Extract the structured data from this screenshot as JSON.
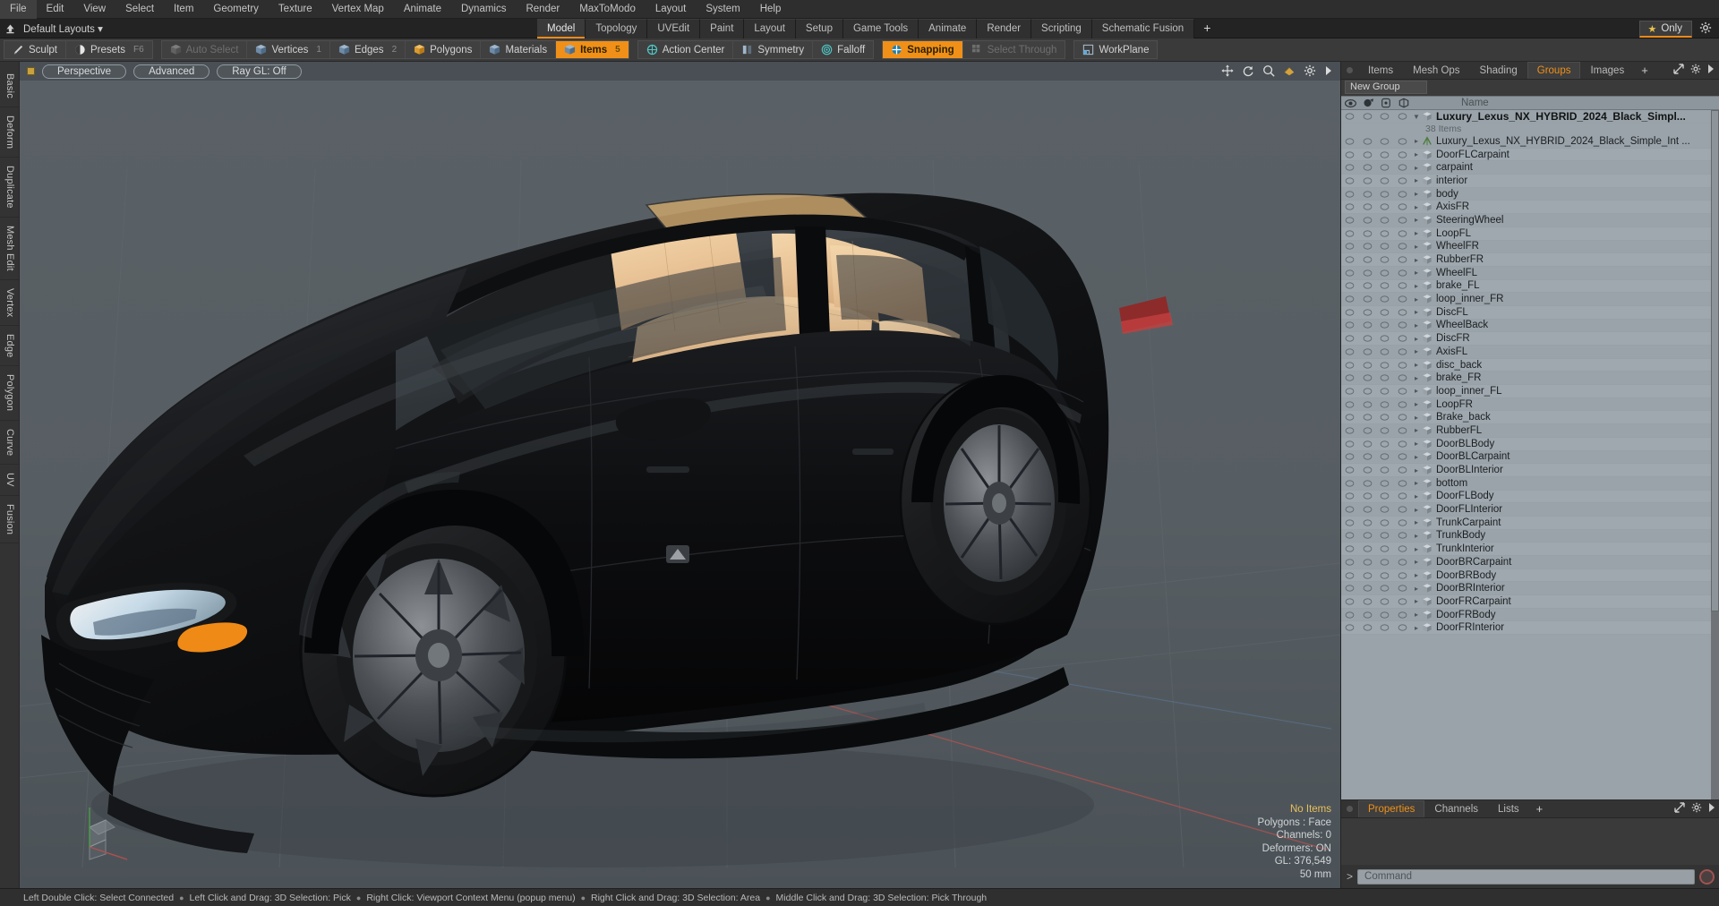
{
  "menubar": {
    "items": [
      "File",
      "Edit",
      "View",
      "Select",
      "Item",
      "Geometry",
      "Texture",
      "Vertex Map",
      "Animate",
      "Dynamics",
      "Render",
      "MaxToModo",
      "Layout",
      "System",
      "Help"
    ]
  },
  "layoutbar": {
    "home_icon": "home-up-arrow-icon",
    "layouts_label": "Default Layouts",
    "layouts_caret": "▾",
    "tabs": [
      {
        "label": "Model",
        "active": true
      },
      {
        "label": "Topology",
        "active": false
      },
      {
        "label": "UVEdit",
        "active": false
      },
      {
        "label": "Paint",
        "active": false
      },
      {
        "label": "Layout",
        "active": false
      },
      {
        "label": "Setup",
        "active": false
      },
      {
        "label": "Game Tools",
        "active": false
      },
      {
        "label": "Animate",
        "active": false
      },
      {
        "label": "Render",
        "active": false
      },
      {
        "label": "Scripting",
        "active": false
      },
      {
        "label": "Schematic Fusion",
        "active": false
      }
    ],
    "add_tab_label": "+",
    "only_label": "Only",
    "only_star": "★",
    "gear_icon": "gear-icon"
  },
  "modebar": {
    "groups": [
      {
        "buttons": [
          {
            "label": "Sculpt",
            "icon": "brush-icon",
            "state": "normal",
            "key": ""
          },
          {
            "label": "Presets",
            "icon": "sphere-icon",
            "state": "normal",
            "key": "F6"
          }
        ]
      },
      {
        "buttons": [
          {
            "label": "Auto Select",
            "icon": "cube-grey-icon",
            "state": "dim",
            "key": ""
          },
          {
            "label": "Vertices",
            "icon": "cube-blue-icon",
            "state": "normal",
            "key": "1"
          },
          {
            "label": "Edges",
            "icon": "cube-blue-icon",
            "state": "normal",
            "key": "2"
          },
          {
            "label": "Polygons",
            "icon": "cube-orange-icon",
            "state": "normal",
            "key": ""
          },
          {
            "label": "Materials",
            "icon": "cube-blue-icon",
            "state": "normal",
            "key": ""
          },
          {
            "label": "Items",
            "icon": "cube-blue-icon",
            "state": "on",
            "key": "5"
          }
        ]
      },
      {
        "buttons": [
          {
            "label": "Action Center",
            "icon": "action-center-icon",
            "state": "normal",
            "key": ""
          },
          {
            "label": "Symmetry",
            "icon": "symmetry-icon",
            "state": "normal",
            "key": ""
          },
          {
            "label": "Falloff",
            "icon": "falloff-icon",
            "state": "normal",
            "key": ""
          }
        ]
      },
      {
        "buttons": [
          {
            "label": "Snapping",
            "icon": "snapping-icon",
            "state": "on",
            "key": ""
          },
          {
            "label": "Select Through",
            "icon": "select-through-icon",
            "state": "dim",
            "key": ""
          }
        ]
      },
      {
        "buttons": [
          {
            "label": "WorkPlane",
            "icon": "workplane-icon",
            "state": "normal",
            "key": ""
          }
        ]
      }
    ]
  },
  "left_tabs": [
    "Basic",
    "Deform",
    "Duplicate",
    "Mesh Edit",
    "Vertex",
    "Edge",
    "Polygon",
    "Curve",
    "UV",
    "Fusion"
  ],
  "viewport": {
    "pills": [
      "Perspective",
      "Advanced",
      "Ray GL: Off"
    ],
    "icons": [
      "move-icon",
      "rotate-icon",
      "zoom-icon",
      "pan-icon",
      "gear-icon",
      "chevron-right-icon"
    ],
    "stats": {
      "selection": "No Items",
      "polygons": "Polygons : Face",
      "channels": "Channels: 0",
      "deformers": "Deformers: ON",
      "gl": "GL: 376,549",
      "grid": "50 mm"
    }
  },
  "right_panel": {
    "tabs": [
      {
        "label": "Items",
        "active": false
      },
      {
        "label": "Mesh Ops",
        "active": false
      },
      {
        "label": "Shading",
        "active": false
      },
      {
        "label": "Groups",
        "active": true
      },
      {
        "label": "Images",
        "active": false
      }
    ],
    "add_tab_label": "+",
    "expand_icon": "expand-icon",
    "gear_icon": "gear-icon",
    "more_icon": "chevron-right-icon",
    "new_group_label": "New Group",
    "list_header": {
      "col_eye": "eye-icon",
      "col_render": "render-icon",
      "col_lock": "lock-icon",
      "col_shade": "shade-icon",
      "name": "Name"
    },
    "root_item": "Luxury_Lexus_NX_HYBRID_2024_Black_Simpl...",
    "root_count": "38 Items",
    "items": [
      "Luxury_Lexus_NX_HYBRID_2024_Black_Simple_Int ...",
      "DoorFLCarpaint",
      "carpaint",
      "interior",
      "body",
      "AxisFR",
      "SteeringWheel",
      "LoopFL",
      "WheelFR",
      "RubberFR",
      "WheelFL",
      "brake_FL",
      "loop_inner_FR",
      "DiscFL",
      "WheelBack",
      "DiscFR",
      "AxisFL",
      "disc_back",
      "brake_FR",
      "loop_inner_FL",
      "LoopFR",
      "Brake_back",
      "RubberFL",
      "DoorBLBody",
      "DoorBLCarpaint",
      "DoorBLInterior",
      "bottom",
      "DoorFLBody",
      "DoorFLInterior",
      "TrunkCarpaint",
      "TrunkBody",
      "TrunkInterior",
      "DoorBRCarpaint",
      "DoorBRBody",
      "DoorBRInterior",
      "DoorFRCarpaint",
      "DoorFRBody",
      "DoorFRInterior"
    ],
    "bottom_tabs": [
      {
        "label": "Properties",
        "active": true
      },
      {
        "label": "Channels",
        "active": false
      },
      {
        "label": "Lists",
        "active": false
      }
    ],
    "bottom_add_label": "+",
    "command_placeholder": "Command",
    "command_value": "",
    "record_icon": "record-icon"
  },
  "statusbar": {
    "hints": [
      "Left Double Click: Select Connected",
      "Left Click and Drag: 3D Selection: Pick",
      "Right Click: Viewport Context Menu (popup menu)",
      "Right Click and Drag: 3D Selection: Area",
      "Middle Click and Drag: 3D Selection: Pick Through"
    ],
    "separator": "●"
  },
  "colors": {
    "accent": "#f09018",
    "panel": "#3a3a3a",
    "list": "#9aa3a9",
    "viewport": "#52595e"
  }
}
